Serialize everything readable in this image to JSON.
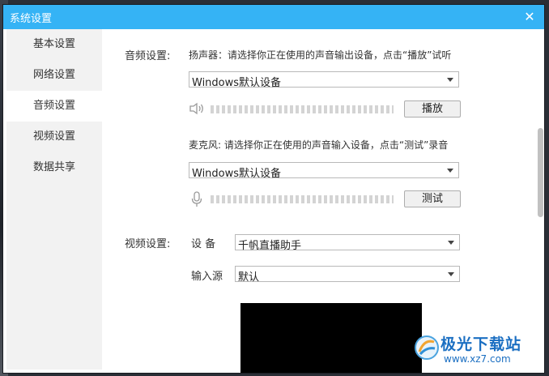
{
  "window": {
    "title": "系统设置"
  },
  "sidebar": {
    "items": [
      {
        "label": "基本设置"
      },
      {
        "label": "网络设置"
      },
      {
        "label": "音频设置"
      },
      {
        "label": "视频设置"
      },
      {
        "label": "数据共享"
      }
    ],
    "active_index": 2
  },
  "audio": {
    "section_label": "音频设置:",
    "speaker_hint": "扬声器：请选择你正在使用的声音输出设备，点击“播放”试听",
    "speaker_device": "Windows默认设备",
    "play_button": "播放",
    "mic_hint": "麦克风: 请选择你正在使用的声音输入设备，点击“测试”录音",
    "mic_device": "Windows默认设备",
    "test_button": "测试"
  },
  "video": {
    "section_label": "视频设置:",
    "device_label": "设 备",
    "device_value": "千帆直播助手",
    "source_label": "输入源",
    "source_value": "默认"
  },
  "watermark": {
    "brand": "极光下载站",
    "url": "www.xz7.com"
  },
  "colors": {
    "titlebar": "#35b3f5",
    "sidebar": "#f2f2f2",
    "preview": "#000000"
  }
}
